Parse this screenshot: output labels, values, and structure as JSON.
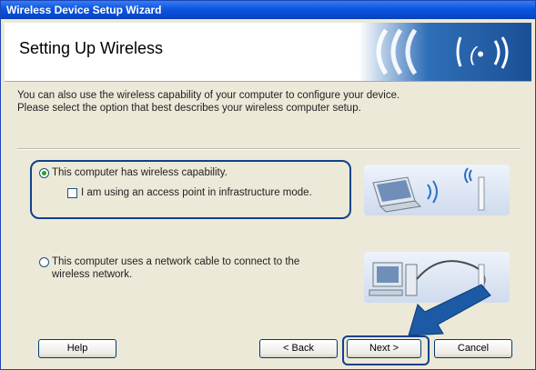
{
  "window": {
    "title": "Wireless Device Setup Wizard"
  },
  "header": {
    "title": "Setting Up Wireless"
  },
  "intro": {
    "line1": "You can also use the wireless capability of your computer to configure your device.",
    "line2": "Please select the option that best describes your wireless computer setup."
  },
  "options": {
    "wireless": {
      "label": "This computer has wireless capability.",
      "selected": true
    },
    "access_point": {
      "label": "I am using an access point in infrastructure mode.",
      "checked": false
    },
    "cable": {
      "line1": "This computer uses a network cable to connect to the",
      "line2": "wireless network.",
      "selected": false
    }
  },
  "buttons": {
    "help": "Help",
    "back": "< Back",
    "next": "Next >",
    "cancel": "Cancel"
  },
  "colors": {
    "titlebar": "#0a55e0",
    "accent_outline": "#10428a",
    "arrow": "#1c5aa6"
  }
}
